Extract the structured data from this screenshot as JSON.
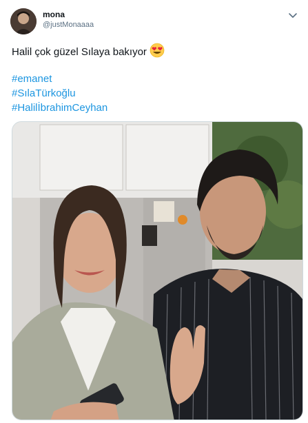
{
  "author": {
    "display_name": "mona",
    "handle": "@justMonaaaa",
    "avatar": "avatar-photo"
  },
  "tweet": {
    "text": "Halil çok güzel Sılaya bakıyor",
    "emoji": "heart-eyes-emoji",
    "hashtags": [
      "#emanet",
      "#SılaTürkoğlu",
      "#HalilİbrahimCeyhan"
    ]
  },
  "media": {
    "kind": "photo",
    "description_icon": "photo-image"
  },
  "icons": {
    "more": "chevron-down-icon"
  },
  "colors": {
    "link": "#1b95e0",
    "text": "#0f1419",
    "muted": "#5b7083"
  }
}
